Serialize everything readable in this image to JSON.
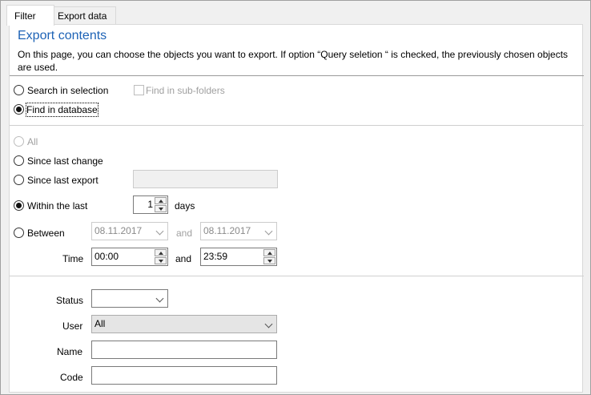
{
  "tabs": [
    {
      "label": "Filter",
      "active": true
    },
    {
      "label": "Export data",
      "active": false
    }
  ],
  "header": {
    "title": "Export contents",
    "description": "On this page, you can choose the objects you want to export. If option “Query seletion “ is checked, the previously chosen objects are used."
  },
  "scope": {
    "search_in_selection": "Search in selection",
    "find_in_subfolders": "Find in sub-folders",
    "find_in_database": "Find in database",
    "selected": "find_in_database"
  },
  "time_filter": {
    "all": "All",
    "since_last_change": "Since last change",
    "since_last_export": "Since last export",
    "since_last_export_value": "",
    "within_the_last": "Within the last",
    "within_value": "1",
    "days": "days",
    "between": "Between",
    "between_from": "08.11.2017",
    "and_label": "and",
    "between_to": "08.11.2017",
    "time_label": "Time",
    "time_from": "00:00",
    "time_to": "23:59",
    "selected": "within_the_last"
  },
  "fields": {
    "status_label": "Status",
    "status_value": "",
    "user_label": "User",
    "user_value": "All",
    "name_label": "Name",
    "name_value": "",
    "code_label": "Code",
    "code_value": ""
  }
}
